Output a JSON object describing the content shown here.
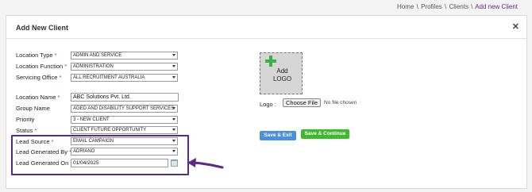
{
  "breadcrumb": {
    "home": "Home",
    "sep": "\\",
    "profiles": "Profiles",
    "clients": "Clients",
    "current": "Add new Client"
  },
  "panel": {
    "title": "Add New Client",
    "close": "✕"
  },
  "form": {
    "location_type": {
      "label": "Location Type",
      "required": "*",
      "value": "ADMIN AND SERVICE"
    },
    "location_function": {
      "label": "Location Function",
      "required": "*",
      "value": "ADMINISTRATION"
    },
    "servicing_office": {
      "label": "Servicing Office",
      "required": "*",
      "value": "ALL RECRUITMENT AUSTRALIA"
    },
    "location_name": {
      "label": "Location Name",
      "required": "*",
      "value": "ABC Solutions Pvt. Ltd."
    },
    "group_name": {
      "label": "Group Name",
      "value": "AGED AND DISABILITY SUPPORT SERVICES"
    },
    "priority": {
      "label": "Priority",
      "value": "3 - NEW CLIENT"
    },
    "status": {
      "label": "Status",
      "required": "*",
      "value": "CLIENT FUTURE OPPORTUNITY"
    },
    "lead_source": {
      "label": "Lead Source",
      "required": "*",
      "value": "EMAIL CAMPAIGN"
    },
    "lead_generated_by": {
      "label": "Lead Generated By",
      "required": "*",
      "value": "ADRIANO"
    },
    "lead_generated_on": {
      "label": "Lead Generated On",
      "required": "*",
      "value": "01/04/2025"
    }
  },
  "logo": {
    "add_text": "Add",
    "logo_text": "LOGO",
    "label": "Logo :",
    "choose_file": "Choose File",
    "file_status": "No file chosen"
  },
  "actions": {
    "save_exit": "Save & Exit",
    "save_continue": "Save & Continue"
  },
  "colors": {
    "accent_purple": "#5a2a84",
    "required_red": "#d32f2f",
    "save_exit_blue": "#4a8fe0",
    "save_continue_green": "#3fba2f",
    "plus_green": "#3cb043"
  }
}
